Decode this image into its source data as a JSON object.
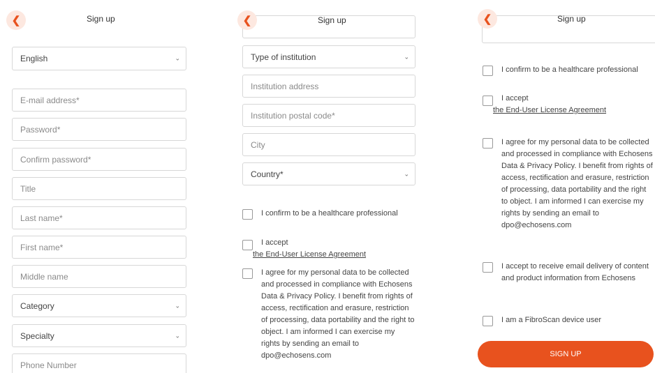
{
  "header": {
    "back_icon": "chevron-left-icon",
    "title": "Sign up"
  },
  "panel1": {
    "language": "English",
    "email_placeholder": "E-mail address*",
    "password_placeholder": "Password*",
    "confirm_password_placeholder": "Confirm password*",
    "title_placeholder": "Title",
    "last_name_placeholder": "Last name*",
    "first_name_placeholder": "First name*",
    "middle_name_placeholder": "Middle name",
    "category": "Category",
    "specialty": "Specialty",
    "phone_placeholder": "Phone Number"
  },
  "panel2": {
    "institution_type": "Type of institution",
    "institution_address_placeholder": "Institution address",
    "institution_postal_placeholder": "Institution postal code*",
    "city_placeholder": "City",
    "country": "Country*",
    "confirm_hcp": "I confirm to be a healthcare professional",
    "accept": "I accept",
    "eula_link": "the End-User License Agreement",
    "privacy_consent": "I agree for my personal data to be collected and processed in compliance with Echosens Data & Privacy Policy. I benefit from rights of access, rectification and erasure, restriction of processing, data portability and the right to object. I am informed I can exercise my rights by sending an email to dpo@echosens.com"
  },
  "panel3": {
    "confirm_hcp": "I confirm to be a healthcare professional",
    "accept": "I accept",
    "eula_link": "the End-User License Agreement",
    "privacy_consent": "I agree for my personal data to be collected and processed in compliance with Echosens Data & Privacy Policy. I benefit from rights of access, rectification and erasure, restriction of processing, data portability and the right to object. I am informed I can exercise my rights by sending an email to dpo@echosens.com",
    "email_delivery": "I accept to receive email delivery of content and product information from Echosens",
    "fibroscan_user": "I am a FibroScan device user",
    "signup_button": "SIGN UP"
  }
}
